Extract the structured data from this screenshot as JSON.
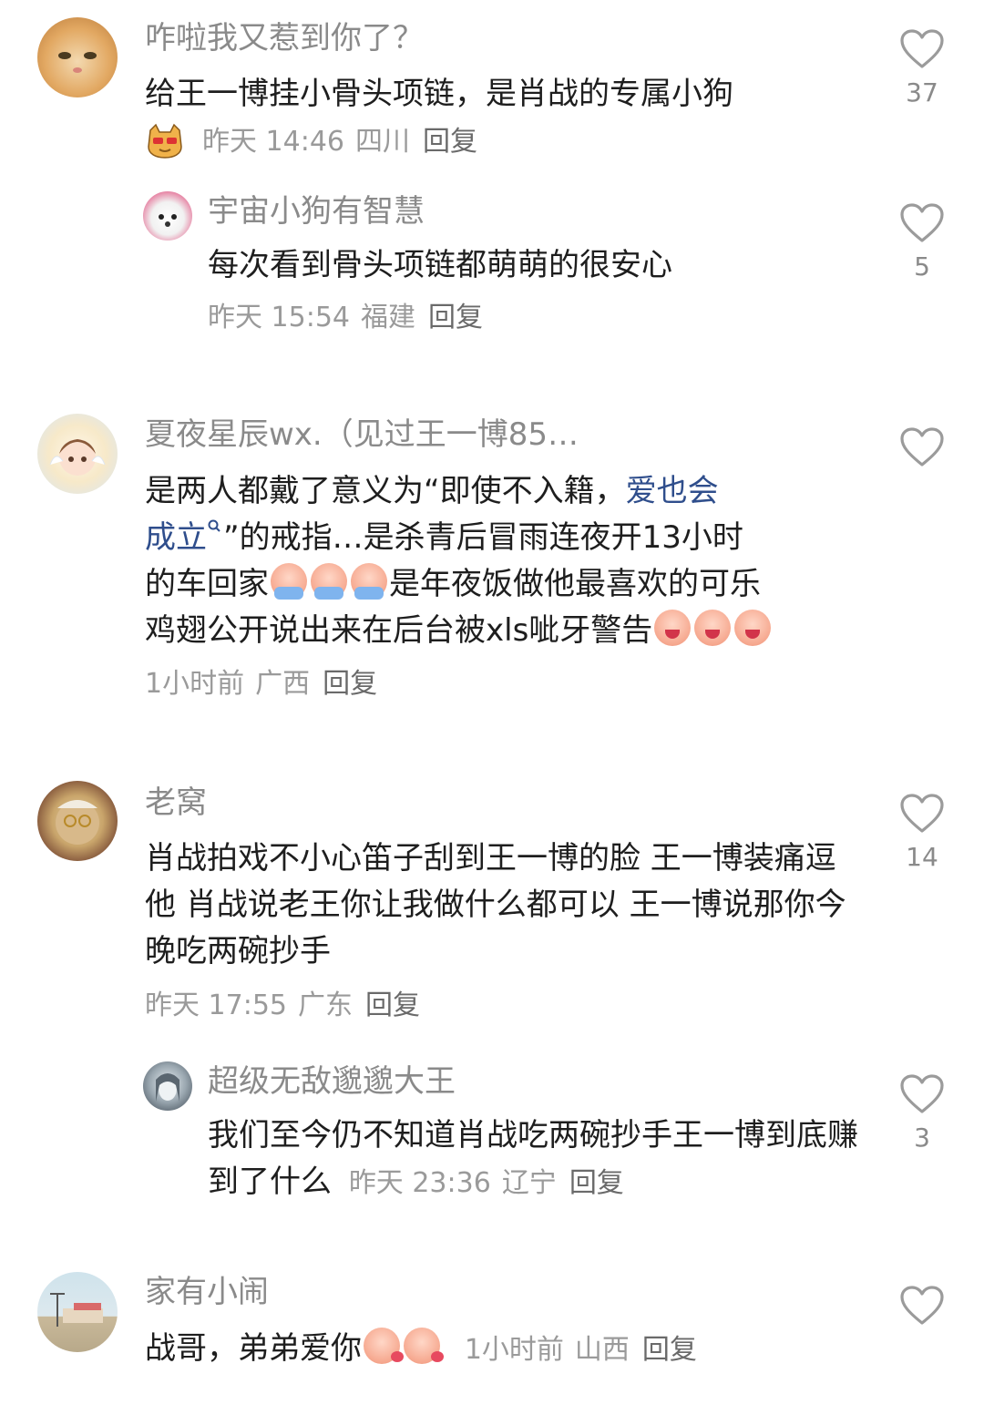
{
  "comments": [
    {
      "name": "咋啦我又惹到你了？",
      "text": "给王一博挂小骨头项链，是肖战的专属小狗",
      "time": "昨天 14:46",
      "location": "四川",
      "reply": "回复",
      "likes": "37",
      "replies": [
        {
          "name": "宇宙小狗有智慧",
          "text": "每次看到骨头项链都萌萌的很安心",
          "time": "昨天 15:54",
          "location": "福建",
          "reply": "回复",
          "likes": "5"
        }
      ]
    },
    {
      "name": "夏夜星辰wx.（见过王一博85…",
      "text_a": "是两人都戴了意义为“即使不入籍，",
      "link": "爱也会成立",
      "link_line1": "爱也会",
      "link_line2": "成立",
      "text_b": "”的戒指…是杀青后冒雨连夜开13小时",
      "text_c": "的车回家",
      "text_d": "是年夜饭做他最喜欢的可乐",
      "text_e": "鸡翅公开说出来在后台被xls呲牙警告",
      "time": "1小时前",
      "location": "广西",
      "reply": "回复",
      "likes": ""
    },
    {
      "name": "老窝",
      "text": "肖战拍戏不小心笛子刮到王一博的脸 王一博装痛逗他 肖战说老王你让我做什么都可以 王一博说那你今晚吃两碗抄手",
      "time": "昨天 17:55",
      "location": "广东",
      "reply": "回复",
      "likes": "14",
      "replies": [
        {
          "name": "超级无敌邈邈大王",
          "text": "我们至今仍不知道肖战吃两碗抄手王一博到底赚到了什么",
          "time": "昨天 23:36",
          "location": "辽宁",
          "reply": "回复",
          "likes": "3"
        }
      ]
    },
    {
      "name": "家有小闹",
      "text": "战哥，弟弟爱你",
      "time": "1小时前",
      "location": "山西",
      "reply": "回复",
      "likes": ""
    }
  ],
  "colors": {
    "name": "#8a8a8a",
    "text": "#1e1e1e",
    "meta": "#9a9a9a",
    "link": "#2f4e8c",
    "heart": "#9b9b9b"
  },
  "icons": [
    "heart-outline-icon",
    "search-icon",
    "emoji-cry-icon",
    "emoji-laugh-icon",
    "emoji-kiss-icon"
  ]
}
